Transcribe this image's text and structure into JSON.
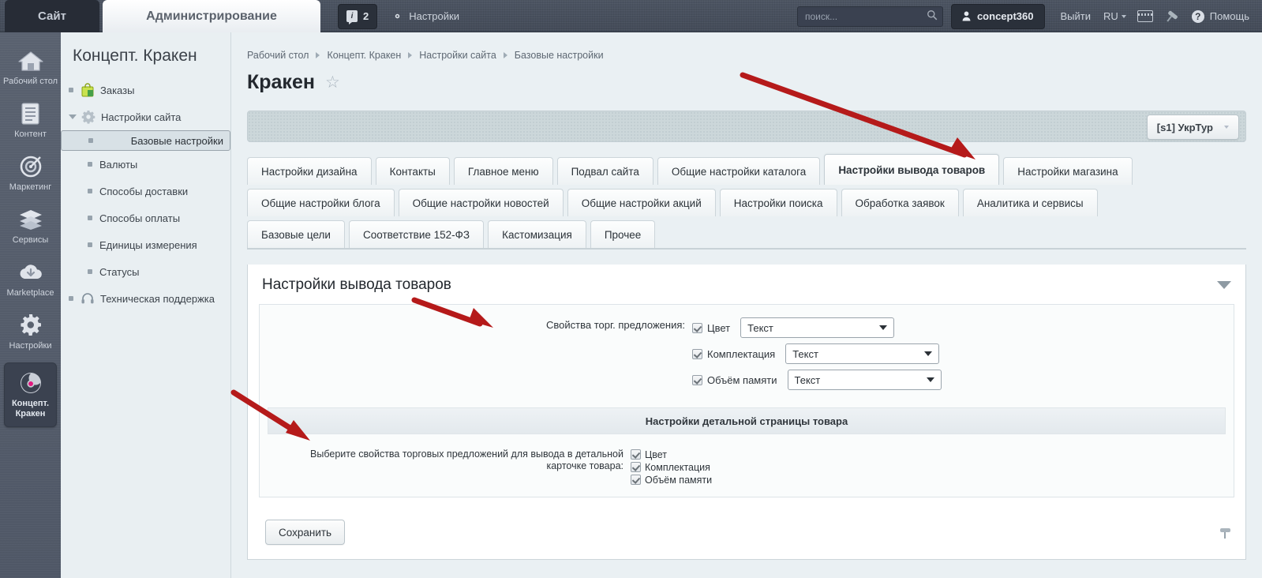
{
  "topbar": {
    "site_button": "Сайт",
    "admin_button": "Администрирование",
    "counter_value": "2",
    "counter_icon": "info-badge-icon",
    "settings_link": "Настройки",
    "settings_icon": "gear-icon",
    "search_placeholder": "поиск...",
    "search_value": "",
    "search_icon": "search-icon",
    "user_name": "concept360",
    "user_icon": "user-icon",
    "logout": "Выйти",
    "language": "RU",
    "keyboard_icon": "keyboard-icon",
    "pin_icon": "pin-icon",
    "help": "Помощь",
    "help_icon": "question-icon"
  },
  "rail": {
    "items": [
      {
        "label": "Рабочий стол",
        "icon": "home-icon",
        "active": false
      },
      {
        "label": "Контент",
        "icon": "document-icon",
        "active": false
      },
      {
        "label": "Маркетинг",
        "icon": "target-icon",
        "active": false
      },
      {
        "label": "Сервисы",
        "icon": "layers-icon",
        "active": false
      },
      {
        "label": "Marketplace",
        "icon": "cloud-download-icon",
        "active": false
      },
      {
        "label": "Настройки",
        "icon": "gear-icon",
        "active": false
      },
      {
        "label": "Концепт. Кракен",
        "icon": "kraken-logo-icon",
        "active": true
      }
    ]
  },
  "leftmenu": {
    "title": "Концепт. Кракен",
    "items": [
      {
        "label": "Заказы",
        "icon": "orders-bag-icon",
        "level": 0,
        "selected": false,
        "expanded": false
      },
      {
        "label": "Настройки сайта",
        "icon": "gear-icon",
        "level": 0,
        "selected": false,
        "expanded": true
      },
      {
        "label": "Базовые настройки",
        "icon": "",
        "level": 1,
        "selected": true,
        "expanded": false
      },
      {
        "label": "Валюты",
        "icon": "",
        "level": 1,
        "selected": false,
        "expanded": false
      },
      {
        "label": "Способы доставки",
        "icon": "",
        "level": 1,
        "selected": false,
        "expanded": false
      },
      {
        "label": "Способы оплаты",
        "icon": "",
        "level": 1,
        "selected": false,
        "expanded": false
      },
      {
        "label": "Единицы измерения",
        "icon": "",
        "level": 1,
        "selected": false,
        "expanded": false
      },
      {
        "label": "Статусы",
        "icon": "",
        "level": 1,
        "selected": false,
        "expanded": false
      },
      {
        "label": "Техническая поддержка",
        "icon": "headset-icon",
        "level": 0,
        "selected": false,
        "expanded": false
      }
    ]
  },
  "breadcrumb": [
    "Рабочий стол",
    "Концепт. Кракен",
    "Настройки сайта",
    "Базовые настройки"
  ],
  "page": {
    "title": "Кракен",
    "favorite_icon": "star-icon"
  },
  "toolbar": {
    "site_selector": "[s1] УкрТур",
    "site_selector_caret": "chevron-down-icon"
  },
  "tabs": {
    "rows": [
      [
        {
          "label": "Настройки дизайна",
          "active": false
        },
        {
          "label": "Контакты",
          "active": false
        },
        {
          "label": "Главное меню",
          "active": false
        },
        {
          "label": "Подвал сайта",
          "active": false
        },
        {
          "label": "Общие настройки каталога",
          "active": false
        },
        {
          "label": "Настройки вывода товаров",
          "active": true
        },
        {
          "label": "Настройки магазина",
          "active": false
        }
      ],
      [
        {
          "label": "Общие настройки блога",
          "active": false
        },
        {
          "label": "Общие настройки новостей",
          "active": false
        },
        {
          "label": "Общие настройки акций",
          "active": false
        },
        {
          "label": "Настройки поиска",
          "active": false
        },
        {
          "label": "Обработка заявок",
          "active": false
        },
        {
          "label": "Аналитика и сервисы",
          "active": false
        }
      ],
      [
        {
          "label": "Базовые цели",
          "active": false
        },
        {
          "label": "Соответствие 152-ФЗ",
          "active": false
        },
        {
          "label": "Кастомизация",
          "active": false
        },
        {
          "label": "Прочее",
          "active": false
        }
      ]
    ],
    "pin_icon": "pin-icon"
  },
  "panel": {
    "title": "Настройки вывода товаров",
    "collapse_icon": "chevron-down-icon",
    "offer_props": {
      "label": "Свойства торг. предложения:",
      "rows": [
        {
          "checkbox_label": "Цвет",
          "checked": true,
          "select_value": "Текст"
        },
        {
          "checkbox_label": "Комплектация",
          "checked": true,
          "select_value": "Текст"
        },
        {
          "checkbox_label": "Объём памяти",
          "checked": true,
          "select_value": "Текст"
        }
      ]
    },
    "detail_section": {
      "header": "Настройки детальной страницы товара",
      "label_line1": "Выберите свойства торговых предложений для вывода в детальной",
      "label_line2": "карточке товара:",
      "checkboxes": [
        {
          "label": "Цвет",
          "checked": true
        },
        {
          "label": "Комплектация",
          "checked": true
        },
        {
          "label": "Объём памяти",
          "checked": true
        }
      ]
    },
    "save_label": "Сохранить",
    "bottom_pin_icon": "pin-icon"
  },
  "annotations": {
    "arrow_color": "#b51a1a",
    "count": 3
  }
}
